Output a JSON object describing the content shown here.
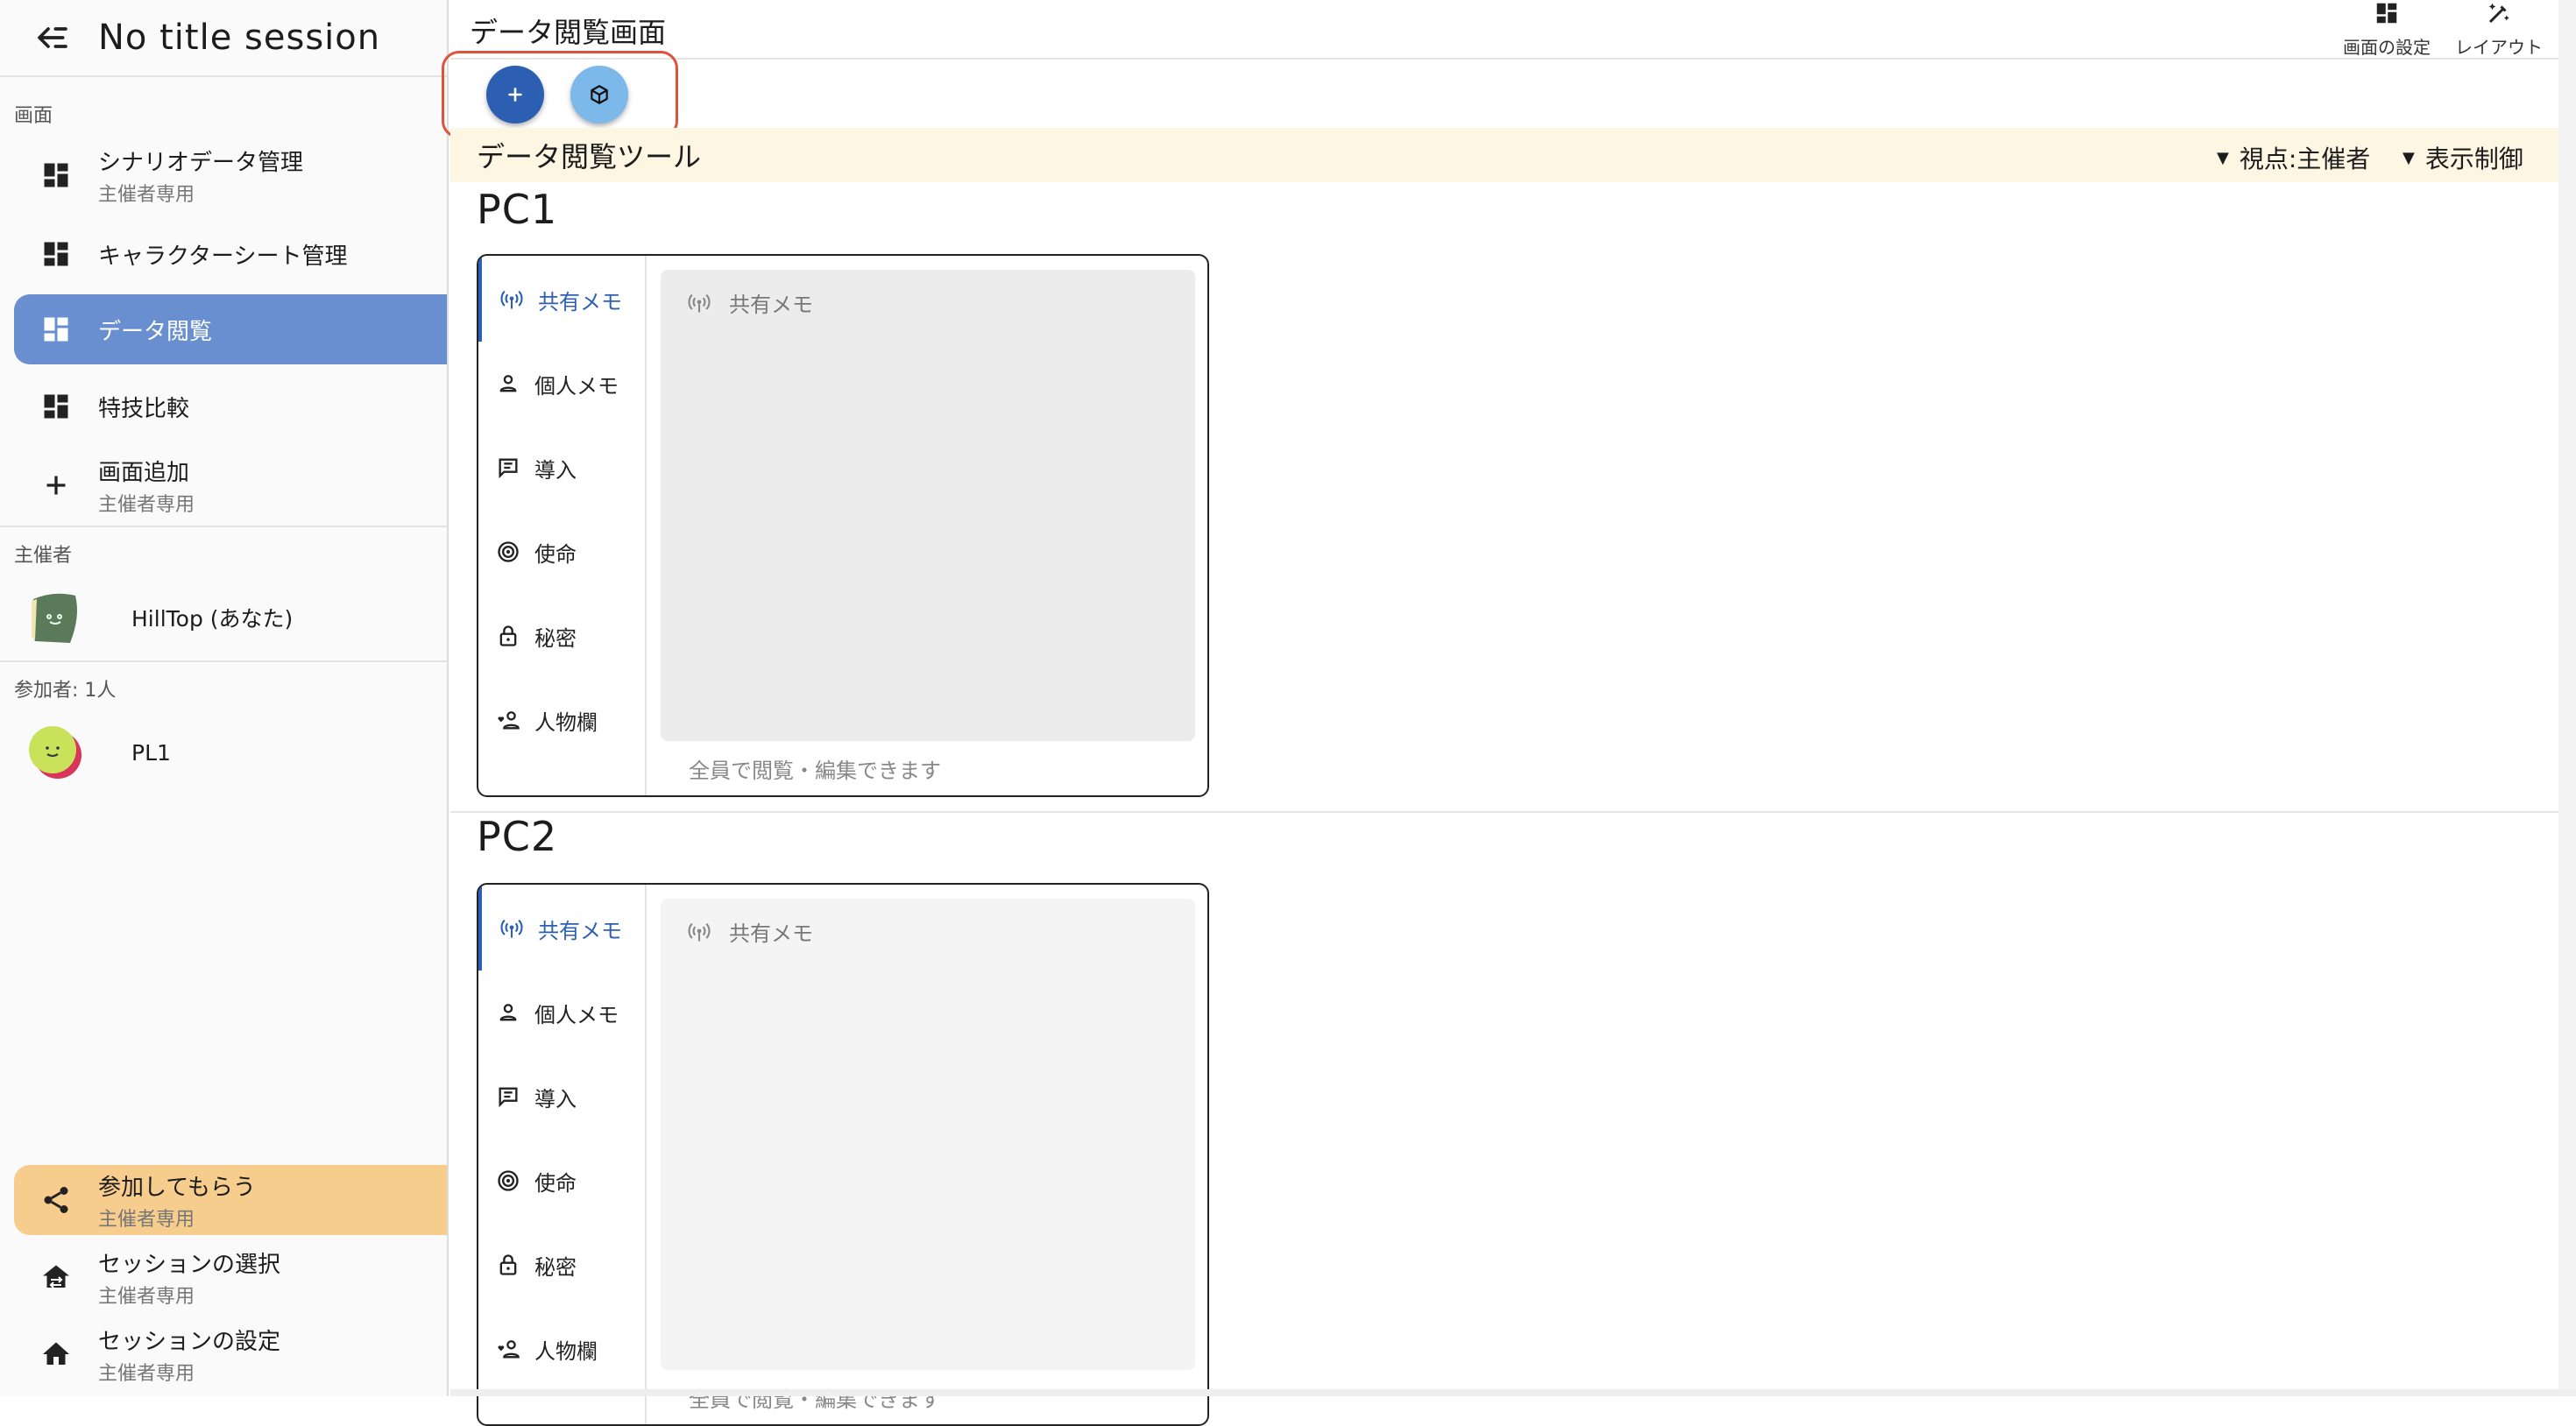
{
  "sidebar": {
    "session_title": "No title session",
    "section_screens": "画面",
    "nav": [
      {
        "label": "シナリオデータ管理",
        "sub": "主催者専用",
        "icon": "dashboard-icon"
      },
      {
        "label": "キャラクターシート管理",
        "sub": "",
        "icon": "dashboard-icon"
      },
      {
        "label": "データ閲覧",
        "sub": "",
        "icon": "dashboard-icon",
        "active": true
      },
      {
        "label": "特技比較",
        "sub": "",
        "icon": "dashboard-icon"
      },
      {
        "label": "画面追加",
        "sub": "主催者専用",
        "icon": "plus-icon"
      }
    ],
    "section_host": "主催者",
    "host": {
      "name": "HillTop (あなた)"
    },
    "section_participants": "参加者: 1人",
    "participants": [
      {
        "name": "PL1"
      }
    ],
    "bottom": [
      {
        "label": "参加してもらう",
        "sub": "主催者専用",
        "icon": "share-icon"
      },
      {
        "label": "セッションの選択",
        "sub": "主催者専用",
        "icon": "house-switch-icon"
      },
      {
        "label": "セッションの設定",
        "sub": "主催者専用",
        "icon": "home-icon"
      }
    ]
  },
  "main": {
    "page_title": "データ閲覧画面",
    "top_buttons": [
      {
        "label": "画面の設定",
        "icon": "grid-icon"
      },
      {
        "label": "レイアウト",
        "icon": "wand-icon"
      }
    ],
    "fabs": [
      {
        "icon": "plus-icon",
        "color": "#2c5fb2"
      },
      {
        "icon": "cube-icon",
        "color": "#7db8ea"
      }
    ],
    "toolbar": {
      "title": "データ閲覧ツール",
      "viewpoint": "視点:主催者",
      "display_control": "表示制御"
    },
    "pcs": [
      {
        "name": "PC1",
        "tabs": [
          "共有メモ",
          "個人メモ",
          "導入",
          "使命",
          "秘密",
          "人物欄"
        ],
        "memo_header": "共有メモ",
        "memo_footer": "全員で閲覧・編集できます"
      },
      {
        "name": "PC2",
        "tabs": [
          "共有メモ",
          "個人メモ",
          "導入",
          "使命",
          "秘密",
          "人物欄"
        ],
        "memo_header": "共有メモ",
        "memo_footer": "全員で閲覧・編集できます"
      }
    ]
  },
  "colors": {
    "accent": "#2d5fb5",
    "active_nav": "#6a8fd0",
    "invite_bg": "#f7cd8d",
    "toolbar_bg": "#fdf6e3",
    "highlight_box": "#e0523a"
  }
}
